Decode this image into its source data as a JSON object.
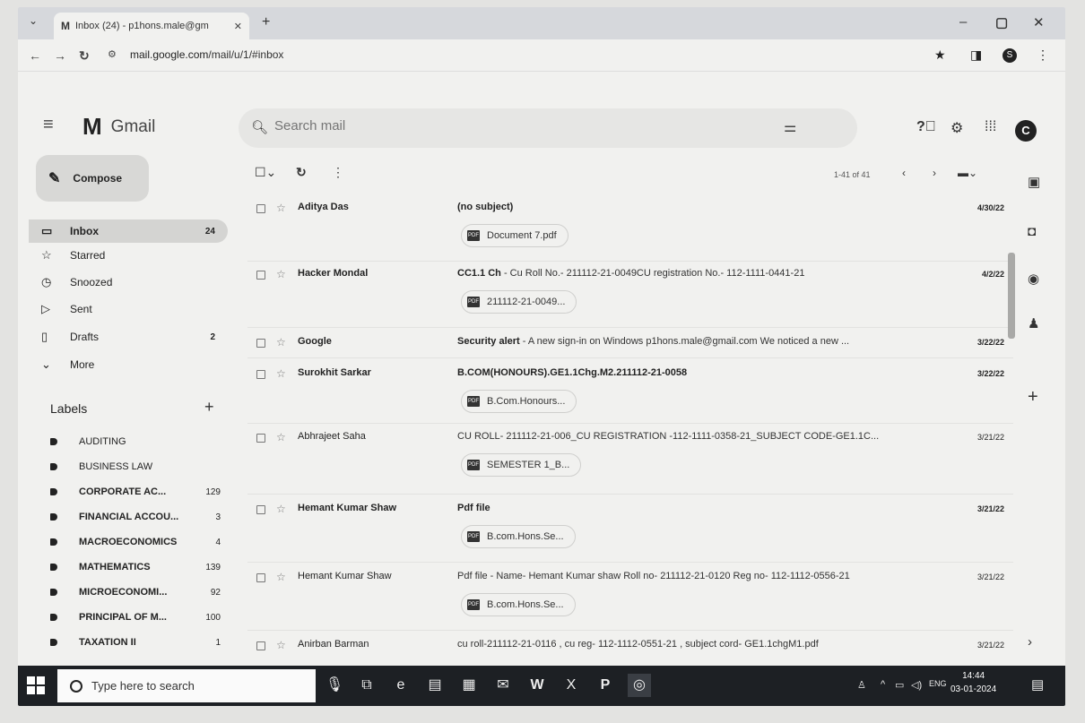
{
  "browser": {
    "tab_title": "Inbox (24) - p1hons.male@gm",
    "tab_logo": "M",
    "url_host": "mail.google.com",
    "url_path": "/mail/u/1/#inbox",
    "profile_initial": "S"
  },
  "gmail": {
    "app_name": "Gmail",
    "search_placeholder": "Search mail",
    "account_initial": "C"
  },
  "sidebar": {
    "compose_label": "Compose",
    "items": [
      {
        "label": "Inbox",
        "count": "24",
        "icon": "inbox-icon"
      },
      {
        "label": "Starred",
        "count": "",
        "icon": "star-icon"
      },
      {
        "label": "Snoozed",
        "count": "",
        "icon": "clock-icon"
      },
      {
        "label": "Sent",
        "count": "",
        "icon": "send-icon"
      },
      {
        "label": "Drafts",
        "count": "2",
        "icon": "draft-icon"
      },
      {
        "label": "More",
        "count": "",
        "icon": "chevron-down-icon"
      }
    ],
    "labels_title": "Labels",
    "labels": [
      {
        "name": "AUDITING",
        "count": ""
      },
      {
        "name": "BUSINESS LAW",
        "count": ""
      },
      {
        "name": "CORPORATE AC...",
        "count": "129"
      },
      {
        "name": "FINANCIAL ACCOU...",
        "count": "3"
      },
      {
        "name": "MACROECONOMICS",
        "count": "4"
      },
      {
        "name": "MATHEMATICS",
        "count": "139"
      },
      {
        "name": "MICROECONOMI...",
        "count": "92"
      },
      {
        "name": "PRINCIPAL OF M...",
        "count": "100"
      },
      {
        "name": "TAXATION II",
        "count": "1"
      }
    ]
  },
  "toolbar": {
    "page_info": "1-41 of 41"
  },
  "emails": [
    {
      "from": "Aditya Das",
      "subject": "(no subject)",
      "snippet": "",
      "date": "4/30/22",
      "attachment": "Document 7.pdf",
      "unread": true
    },
    {
      "from": "Hacker Mondal",
      "subject": "CC1.1 Ch",
      "snippet": " - Cu Roll No.- 211112-21-0049CU registration No.- 112-1111-0441-21",
      "date": "4/2/22",
      "attachment": "211112-21-0049...",
      "unread": true
    },
    {
      "from": "Google",
      "subject": "Security alert",
      "snippet": " - A new sign-in on Windows p1hons.male@gmail.com We noticed a new ...",
      "date": "3/22/22",
      "attachment": "",
      "unread": true
    },
    {
      "from": "Surokhit Sarkar",
      "subject": "B.COM(HONOURS).GE1.1Chg.M2.211112-21-0058",
      "snippet": "",
      "date": "3/22/22",
      "attachment": "B.Com.Honours...",
      "unread": true
    },
    {
      "from": "Abhrajeet Saha",
      "subject": "",
      "snippet": "CU ROLL- 211112-21-006_CU REGISTRATION -112-1111-0358-21_SUBJECT CODE-GE1.1C...",
      "date": "3/21/22",
      "attachment": "SEMESTER 1_B...",
      "unread": false
    },
    {
      "from": "Hemant Kumar Shaw",
      "subject": "Pdf file",
      "snippet": "",
      "date": "3/21/22",
      "attachment": "B.com.Hons.Se...",
      "unread": true
    },
    {
      "from": "Hemant Kumar Shaw",
      "subject": "",
      "snippet": "Pdf file - Name- Hemant Kumar shaw Roll no- 211112-21-0120 Reg no- 112-1112-0556-21",
      "date": "3/21/22",
      "attachment": "B.com.Hons.Se...",
      "unread": false
    },
    {
      "from": "Anirban Barman",
      "subject": "",
      "snippet": "cu roll-211112-21-0116 , cu reg- 112-1112-0551-21 , subject cord- GE1.1chgM1.pdf",
      "date": "3/21/22",
      "attachment": "",
      "unread": false
    }
  ],
  "taskbar": {
    "search_placeholder": "Type here to search",
    "lang": "ENG",
    "time": "14:44",
    "date": "03-01-2024"
  }
}
